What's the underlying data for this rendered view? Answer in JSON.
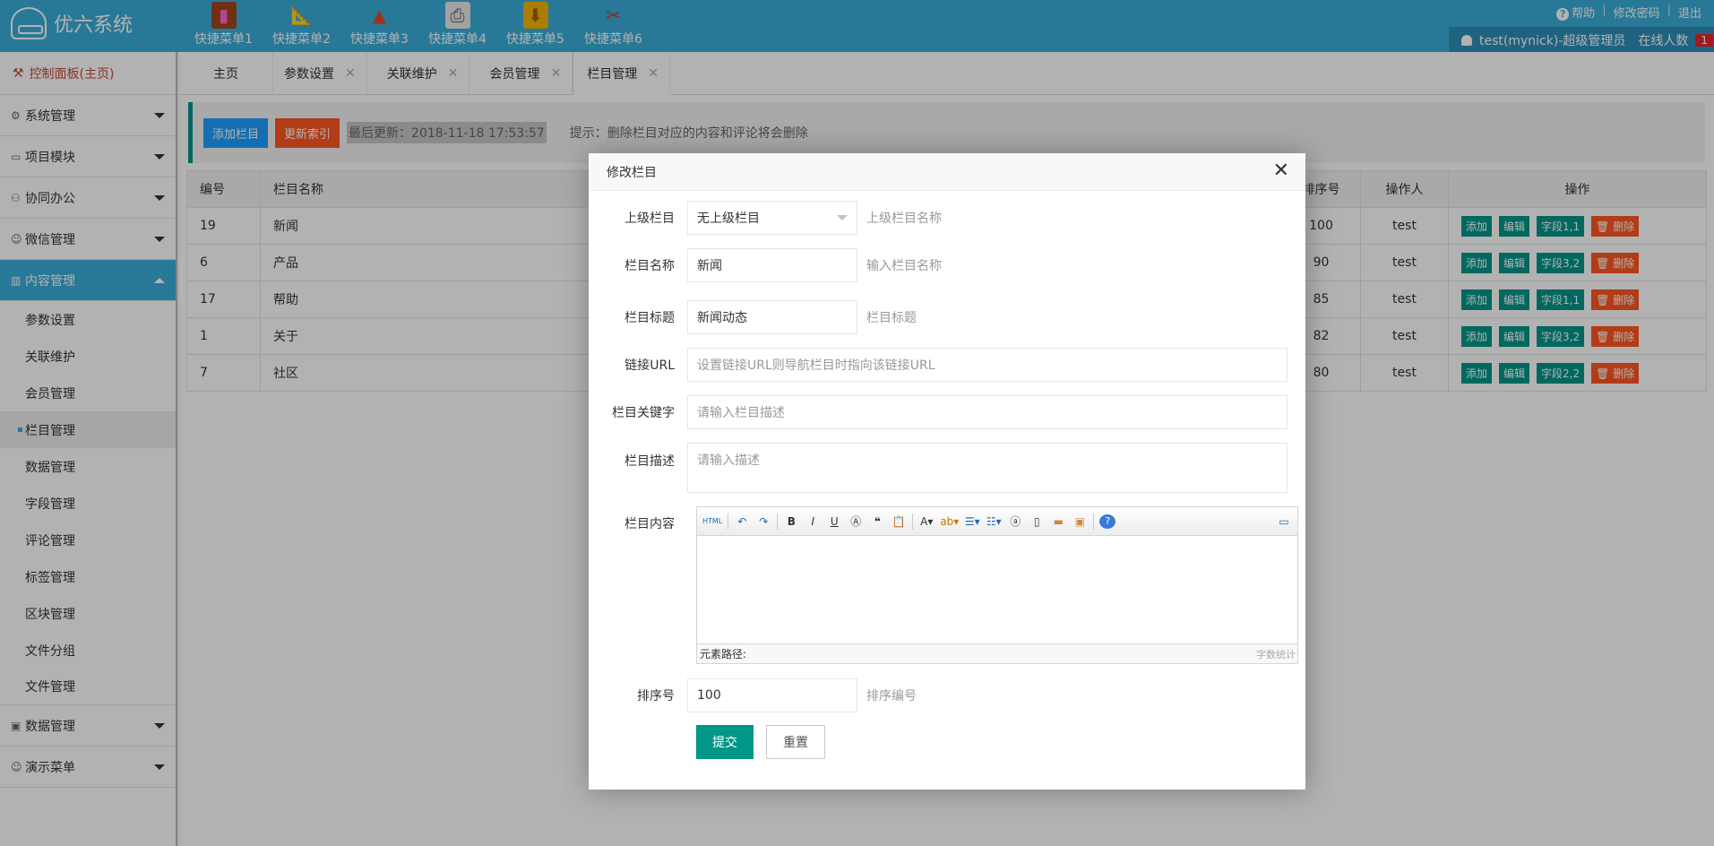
{
  "brand": {
    "name": "优六系统"
  },
  "quick_menu": [
    {
      "label": "快捷菜单1",
      "icon": "book-icon",
      "color": "#a0461e"
    },
    {
      "label": "快捷菜单2",
      "icon": "pencil-ruler-icon",
      "color": "#f0a830"
    },
    {
      "label": "快捷菜单3",
      "icon": "compass-icon",
      "color": "#e04a2b"
    },
    {
      "label": "快捷菜单4",
      "icon": "printer-icon",
      "color": "#e8e8e8"
    },
    {
      "label": "快捷菜单5",
      "icon": "download-folder-icon",
      "color": "#f5b400"
    },
    {
      "label": "快捷菜单6",
      "icon": "tools-icon",
      "color": "#d62e2e"
    }
  ],
  "top_links": {
    "help": "帮助",
    "change_password": "修改密码",
    "logout": "退出"
  },
  "user": {
    "name": "test(mynick)-超级管理员",
    "online_label": "在线人数",
    "online_count": "1"
  },
  "sidebar": {
    "home": "控制面板(主页)",
    "groups": [
      {
        "label": "系统管理",
        "icon": "gear-icon"
      },
      {
        "label": "项目模块",
        "icon": "card-icon"
      },
      {
        "label": "协同办公",
        "icon": "users-icon"
      },
      {
        "label": "微信管理",
        "icon": "wechat-icon"
      },
      {
        "label": "内容管理",
        "icon": "columns-icon"
      }
    ],
    "content_items": [
      "参数设置",
      "关联维护",
      "会员管理",
      "栏目管理",
      "数据管理",
      "字段管理",
      "评论管理",
      "标签管理",
      "区块管理",
      "文件分组",
      "文件管理"
    ],
    "bottom_groups": [
      {
        "label": "数据管理",
        "icon": "image-icon"
      },
      {
        "label": "演示菜单",
        "icon": "smile-icon"
      }
    ]
  },
  "tabs": [
    "主页",
    "参数设置",
    "关联维护",
    "会员管理",
    "栏目管理"
  ],
  "toolbar": {
    "add_label": "添加栏目",
    "reindex_label": "更新索引",
    "last_update": "最后更新：2018-11-18 17:53:57",
    "hint": "提示：删除栏目对应的内容和评论将会删除"
  },
  "table": {
    "headers": {
      "id": "编号",
      "name": "栏目名称",
      "sort": "排序号",
      "operator": "操作人",
      "ops": "操作"
    },
    "rows": [
      {
        "id": "19",
        "name": "新闻",
        "sort": "100",
        "operator": "test",
        "field": "字段1,1"
      },
      {
        "id": "6",
        "name": "产品",
        "sort": "90",
        "operator": "test",
        "field": "字段3,2"
      },
      {
        "id": "17",
        "name": "帮助",
        "sort": "85",
        "operator": "test",
        "field": "字段1,1"
      },
      {
        "id": "1",
        "name": "关于",
        "sort": "82",
        "operator": "test",
        "field": "字段3,2"
      },
      {
        "id": "7",
        "name": "社区",
        "sort": "80",
        "operator": "test",
        "field": "字段2,2"
      }
    ],
    "op_labels": {
      "add": "添加",
      "edit": "编辑",
      "delete": "删除"
    }
  },
  "modal": {
    "title": "修改栏目",
    "parent": {
      "label": "上级栏目",
      "value": "无上级栏目",
      "aux": "上级栏目名称"
    },
    "name": {
      "label": "栏目名称",
      "value": "新闻",
      "aux": "输入栏目名称"
    },
    "title_field": {
      "label": "栏目标题",
      "value": "新闻动态",
      "aux": "栏目标题"
    },
    "url": {
      "label": "链接URL",
      "placeholder": "设置链接URL则导航栏目时指向该链接URL"
    },
    "keywords": {
      "label": "栏目关键字",
      "placeholder": "请输入栏目描述"
    },
    "description": {
      "label": "栏目描述",
      "placeholder": "请输入描述"
    },
    "content": {
      "label": "栏目内容",
      "element_path": "元素路径:",
      "word_count": "字数统计"
    },
    "sort": {
      "label": "排序号",
      "value": "100",
      "aux": "排序编号"
    },
    "submit_label": "提交",
    "reset_label": "重置"
  },
  "colors": {
    "header": "#3aaed8",
    "accent_green": "#009688",
    "danger": "#ff5722",
    "primary": "#1e9fff"
  }
}
